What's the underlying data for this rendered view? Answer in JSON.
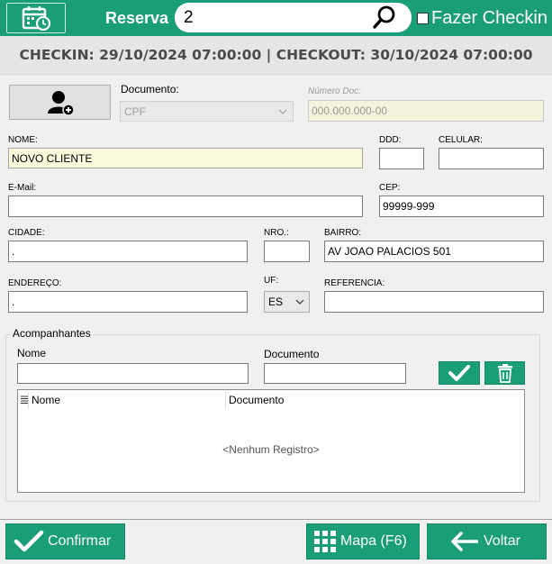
{
  "header": {
    "reserva_label": "Reserva",
    "reserva_value": "2",
    "fazer_checkin_label": "Fazer Checkin",
    "accent": "#1a9e77"
  },
  "subheader": {
    "text": "CHECKIN: 29/10/2024 07:00:00 | CHECKOUT: 30/10/2024 07:00:00"
  },
  "form": {
    "documento_label": "Documento:",
    "documento_value": "CPF",
    "numero_doc_label": "Número Doc:",
    "numero_doc_placeholder": "000.000.000-00",
    "nome_label": "NOME:",
    "nome_value": "NOVO CLIENTE",
    "ddd_label": "DDD:",
    "ddd_value": "",
    "celular_label": "CELULAR:",
    "celular_value": "",
    "email_label": "E-Mail:",
    "email_value": "",
    "cep_label": "CEP:",
    "cep_value": "99999-999",
    "cidade_label": "CIDADE:",
    "cidade_value": ".",
    "nro_label": "NRO.:",
    "nro_value": "",
    "bairro_label": "BAIRRO:",
    "bairro_value": "AV JOAO  PALACIOS 501",
    "endereco_label": "ENDEREÇO:",
    "endereco_value": ".",
    "uf_label": "UF:",
    "uf_value": "ES",
    "referencia_label": "REFERENCIA:",
    "referencia_value": ""
  },
  "acompanhantes": {
    "title": "Acompanhantes",
    "nome_label": "Nome",
    "documento_label": "Documento",
    "columns": [
      "Nome",
      "Documento"
    ],
    "empty_message": "<Nenhum Registro>"
  },
  "footer": {
    "confirmar": "Confirmar",
    "mapa": "Mapa (F6)",
    "voltar": "Voltar"
  },
  "icons": [
    "calendar-clock-icon",
    "search-icon",
    "add-user-icon",
    "check-icon",
    "trash-icon",
    "grid-icon",
    "arrow-left-icon",
    "chevron-down-icon"
  ]
}
